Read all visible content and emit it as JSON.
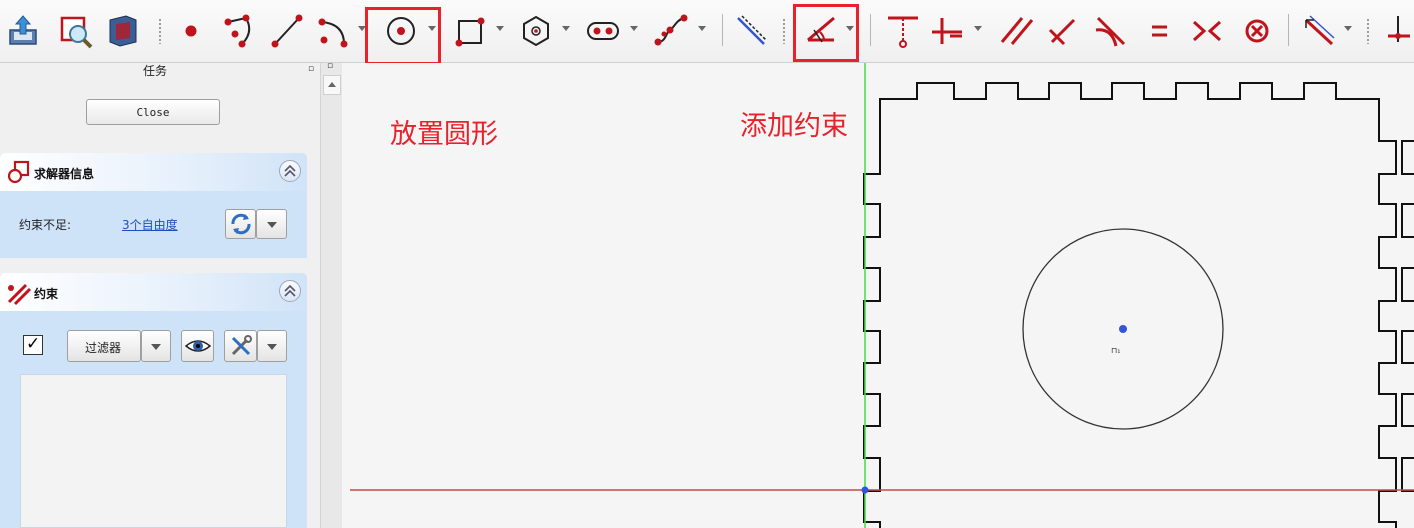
{
  "toolbar": {
    "icons": [
      "export-icon",
      "zoom-select-icon",
      "view-section-icon",
      "point-icon",
      "polyline-icon",
      "line-icon",
      "arc-icon",
      "circle-icon",
      "rectangle-icon",
      "polygon-icon",
      "slot-icon",
      "bspline-icon",
      "construction-toggle-icon",
      "constraint-angle-icon",
      "constraint-vertical-distance-icon",
      "constraint-horizontal-distance-icon",
      "constraint-parallel-icon",
      "constraint-perpendicular-icon",
      "constraint-tangent-icon",
      "constraint-equal-icon",
      "constraint-symmetric-icon",
      "constraint-block-icon",
      "constraint-distance-icon",
      "more-constraints-icon"
    ],
    "accent_color": "#c0141c",
    "highlight_color": "#e8222a"
  },
  "annotations": {
    "place_circle": "放置圆形",
    "add_constraint": "添加约束"
  },
  "task_panel": {
    "title": "任务",
    "close_label": "Close",
    "solver_group": {
      "title": "求解器信息",
      "status_label": "约束不足:",
      "dof_link": "3个自由度"
    },
    "constraints_group": {
      "title": "约束",
      "checkbox_checked": true,
      "filter_label": "过滤器"
    }
  },
  "canvas": {
    "background": "#f5f5f5",
    "vertical_axis_color": "#44dd44",
    "horizontal_axis_color": "#c84a4a",
    "point_color": "#3355dd"
  }
}
